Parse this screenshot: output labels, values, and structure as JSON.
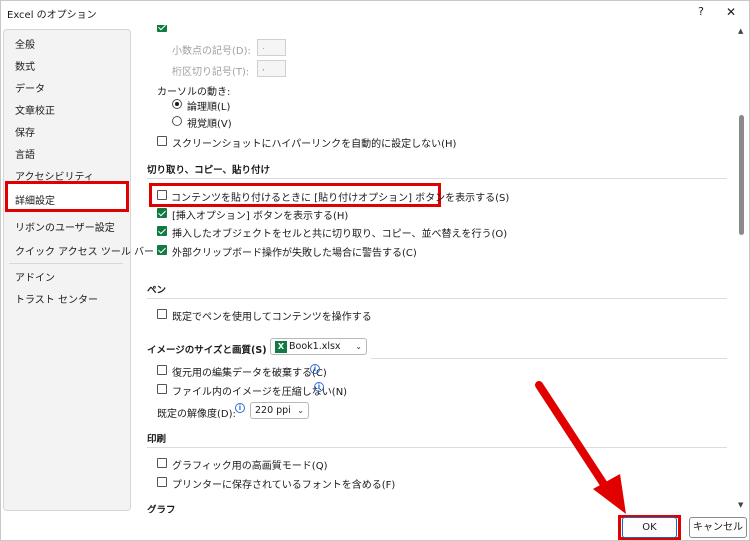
{
  "window": {
    "title": "Excel のオプション",
    "help": "?",
    "close": "✕"
  },
  "nav": {
    "items": [
      "全般",
      "数式",
      "データ",
      "文章校正",
      "保存",
      "言語",
      "アクセシビリティ",
      "詳細設定",
      "リボンのユーザー設定",
      "クイック アクセス ツール バー",
      "アドイン",
      "トラスト センター"
    ],
    "selected": "詳細設定"
  },
  "editing": {
    "decimal_symbol_label": "小数点の記号(D):",
    "decimal_symbol_value": ".",
    "thousands_separator_label": "桁区切り記号(T):",
    "thousands_separator_value": ",",
    "cursor_movement_label": "カーソルの動き:",
    "cursor_logical": "論理順(L)",
    "cursor_visual": "視覚順(V)",
    "no_hyperlink_screenshot": "スクリーンショットにハイパーリンクを自動的に設定しない(H)"
  },
  "cut_copy_paste": {
    "title": "切り取り、コピー、貼り付け",
    "show_paste_options": "コンテンツを貼り付けるときに [貼り付けオプション] ボタンを表示する(S)",
    "show_insert_options": "[挿入オプション] ボタンを表示する(H)",
    "cut_copy_sort_objects": "挿入したオブジェクトをセルと共に切り取り、コピー、並べ替えを行う(O)",
    "clipboard_warning": "外部クリップボード操作が失敗した場合に警告する(C)"
  },
  "pen": {
    "title": "ペン",
    "use_pen_default": "既定でペンを使用してコンテンツを操作する"
  },
  "image_size_quality": {
    "title": "イメージのサイズと画質(S)",
    "workbook": "Book1.xlsx",
    "discard_editing_data": "復元用の編集データを破棄する(C)",
    "do_not_compress": "ファイル内のイメージを圧縮しない(N)",
    "default_resolution_label": "既定の解像度(D):",
    "default_resolution_value": "220 ppi"
  },
  "print": {
    "title": "印刷",
    "high_quality_graphics": "グラフィック用の高画質モード(Q)",
    "printer_fonts": "プリンターに保存されているフォントを含める(F)"
  },
  "chart": {
    "title": "グラフ"
  },
  "footer": {
    "ok": "OK",
    "cancel": "キャンセル"
  },
  "colors": {
    "highlight": "#e00000",
    "checkbox_on": "#107c41"
  }
}
